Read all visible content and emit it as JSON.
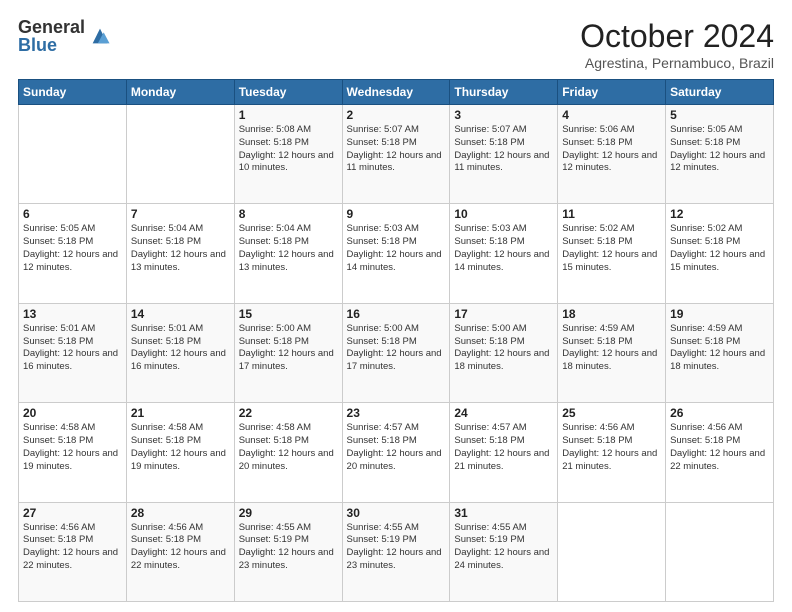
{
  "logo": {
    "general": "General",
    "blue": "Blue"
  },
  "header": {
    "month": "October 2024",
    "location": "Agrestina, Pernambuco, Brazil"
  },
  "days_of_week": [
    "Sunday",
    "Monday",
    "Tuesday",
    "Wednesday",
    "Thursday",
    "Friday",
    "Saturday"
  ],
  "weeks": [
    [
      {
        "day": "",
        "info": ""
      },
      {
        "day": "",
        "info": ""
      },
      {
        "day": "1",
        "info": "Sunrise: 5:08 AM\nSunset: 5:18 PM\nDaylight: 12 hours and 10 minutes."
      },
      {
        "day": "2",
        "info": "Sunrise: 5:07 AM\nSunset: 5:18 PM\nDaylight: 12 hours and 11 minutes."
      },
      {
        "day": "3",
        "info": "Sunrise: 5:07 AM\nSunset: 5:18 PM\nDaylight: 12 hours and 11 minutes."
      },
      {
        "day": "4",
        "info": "Sunrise: 5:06 AM\nSunset: 5:18 PM\nDaylight: 12 hours and 12 minutes."
      },
      {
        "day": "5",
        "info": "Sunrise: 5:05 AM\nSunset: 5:18 PM\nDaylight: 12 hours and 12 minutes."
      }
    ],
    [
      {
        "day": "6",
        "info": "Sunrise: 5:05 AM\nSunset: 5:18 PM\nDaylight: 12 hours and 12 minutes."
      },
      {
        "day": "7",
        "info": "Sunrise: 5:04 AM\nSunset: 5:18 PM\nDaylight: 12 hours and 13 minutes."
      },
      {
        "day": "8",
        "info": "Sunrise: 5:04 AM\nSunset: 5:18 PM\nDaylight: 12 hours and 13 minutes."
      },
      {
        "day": "9",
        "info": "Sunrise: 5:03 AM\nSunset: 5:18 PM\nDaylight: 12 hours and 14 minutes."
      },
      {
        "day": "10",
        "info": "Sunrise: 5:03 AM\nSunset: 5:18 PM\nDaylight: 12 hours and 14 minutes."
      },
      {
        "day": "11",
        "info": "Sunrise: 5:02 AM\nSunset: 5:18 PM\nDaylight: 12 hours and 15 minutes."
      },
      {
        "day": "12",
        "info": "Sunrise: 5:02 AM\nSunset: 5:18 PM\nDaylight: 12 hours and 15 minutes."
      }
    ],
    [
      {
        "day": "13",
        "info": "Sunrise: 5:01 AM\nSunset: 5:18 PM\nDaylight: 12 hours and 16 minutes."
      },
      {
        "day": "14",
        "info": "Sunrise: 5:01 AM\nSunset: 5:18 PM\nDaylight: 12 hours and 16 minutes."
      },
      {
        "day": "15",
        "info": "Sunrise: 5:00 AM\nSunset: 5:18 PM\nDaylight: 12 hours and 17 minutes."
      },
      {
        "day": "16",
        "info": "Sunrise: 5:00 AM\nSunset: 5:18 PM\nDaylight: 12 hours and 17 minutes."
      },
      {
        "day": "17",
        "info": "Sunrise: 5:00 AM\nSunset: 5:18 PM\nDaylight: 12 hours and 18 minutes."
      },
      {
        "day": "18",
        "info": "Sunrise: 4:59 AM\nSunset: 5:18 PM\nDaylight: 12 hours and 18 minutes."
      },
      {
        "day": "19",
        "info": "Sunrise: 4:59 AM\nSunset: 5:18 PM\nDaylight: 12 hours and 18 minutes."
      }
    ],
    [
      {
        "day": "20",
        "info": "Sunrise: 4:58 AM\nSunset: 5:18 PM\nDaylight: 12 hours and 19 minutes."
      },
      {
        "day": "21",
        "info": "Sunrise: 4:58 AM\nSunset: 5:18 PM\nDaylight: 12 hours and 19 minutes."
      },
      {
        "day": "22",
        "info": "Sunrise: 4:58 AM\nSunset: 5:18 PM\nDaylight: 12 hours and 20 minutes."
      },
      {
        "day": "23",
        "info": "Sunrise: 4:57 AM\nSunset: 5:18 PM\nDaylight: 12 hours and 20 minutes."
      },
      {
        "day": "24",
        "info": "Sunrise: 4:57 AM\nSunset: 5:18 PM\nDaylight: 12 hours and 21 minutes."
      },
      {
        "day": "25",
        "info": "Sunrise: 4:56 AM\nSunset: 5:18 PM\nDaylight: 12 hours and 21 minutes."
      },
      {
        "day": "26",
        "info": "Sunrise: 4:56 AM\nSunset: 5:18 PM\nDaylight: 12 hours and 22 minutes."
      }
    ],
    [
      {
        "day": "27",
        "info": "Sunrise: 4:56 AM\nSunset: 5:18 PM\nDaylight: 12 hours and 22 minutes."
      },
      {
        "day": "28",
        "info": "Sunrise: 4:56 AM\nSunset: 5:18 PM\nDaylight: 12 hours and 22 minutes."
      },
      {
        "day": "29",
        "info": "Sunrise: 4:55 AM\nSunset: 5:19 PM\nDaylight: 12 hours and 23 minutes."
      },
      {
        "day": "30",
        "info": "Sunrise: 4:55 AM\nSunset: 5:19 PM\nDaylight: 12 hours and 23 minutes."
      },
      {
        "day": "31",
        "info": "Sunrise: 4:55 AM\nSunset: 5:19 PM\nDaylight: 12 hours and 24 minutes."
      },
      {
        "day": "",
        "info": ""
      },
      {
        "day": "",
        "info": ""
      }
    ]
  ]
}
